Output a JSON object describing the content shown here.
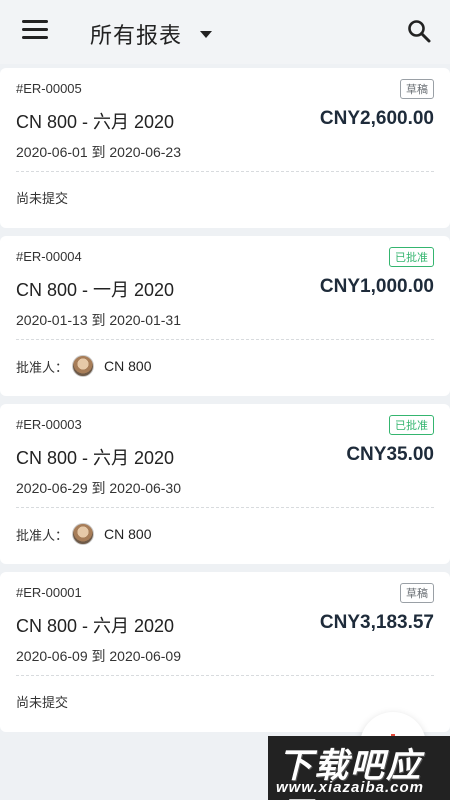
{
  "header": {
    "title": "所有报表",
    "menu_icon": "hamburger-icon",
    "search_icon": "search-icon"
  },
  "reports": [
    {
      "id": "#ER-00005",
      "status": "草稿",
      "name": "CN 800 - 六月 2020",
      "amount": "CNY2,600.00",
      "dates": "2020-06-01 到 2020-06-23",
      "footer_text": "尚未提交",
      "approver_label": "",
      "approver_name": ""
    },
    {
      "id": "#ER-00004",
      "status": "已批准",
      "name": "CN 800 - 一月 2020",
      "amount": "CNY1,000.00",
      "dates": "2020-01-13 到 2020-01-31",
      "footer_text": "",
      "approver_label": "批准人：",
      "approver_name": "CN 800"
    },
    {
      "id": "#ER-00003",
      "status": "已批准",
      "name": "CN 800 - 六月 2020",
      "amount": "CNY35.00",
      "dates": "2020-06-29 到 2020-06-30",
      "footer_text": "",
      "approver_label": "批准人：",
      "approver_name": "CN 800"
    },
    {
      "id": "#ER-00001",
      "status": "草稿",
      "name": "CN 800 - 六月 2020",
      "amount": "CNY3,183.57",
      "dates": "2020-06-09 到 2020-06-09",
      "footer_text": "尚未提交",
      "approver_label": "",
      "approver_name": ""
    }
  ],
  "watermark": {
    "main": "下载吧应用",
    "sub": "www.xiazaiba.com"
  },
  "colors": {
    "approved": "#34b56f",
    "draft": "#6b7075",
    "fab_plus": "#e74c3c"
  }
}
